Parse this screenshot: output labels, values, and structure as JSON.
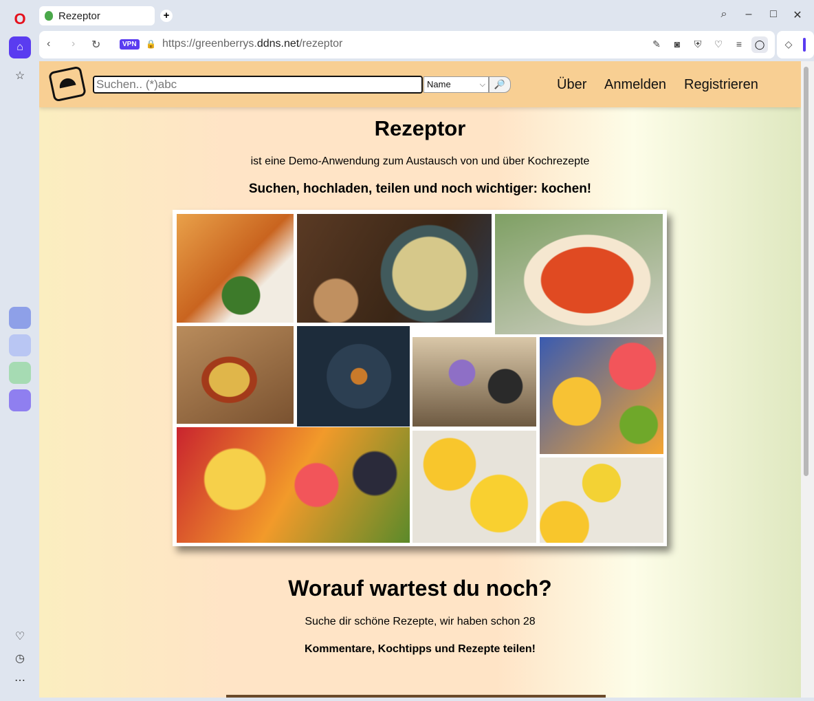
{
  "browser": {
    "tab_title": "Rezeptor",
    "new_tab": "+",
    "vpn": "VPN",
    "url_prefix": "https://greenberrys.",
    "url_domain": "ddns.net",
    "url_path": "/rezeptor"
  },
  "header": {
    "search_placeholder": "Suchen.. (*)abc",
    "select_value": "Name",
    "nav": [
      "Über",
      "Anmelden",
      "Registrieren"
    ]
  },
  "main": {
    "title": "Rezeptor",
    "intro": "ist eine Demo-Anwendung zum Austausch von und über Kochrezepte",
    "tagline": "Suchen, hochladen, teilen und noch wichtiger: kochen!",
    "heading2": "Worauf wartest du noch?",
    "line3": "Suche dir schöne Rezepte, wir haben schon 28",
    "line4": "Kommentare, Kochtipps und Rezepte teilen!"
  },
  "colors": {
    "header_bg": "#f8cf93",
    "accent": "#5a3cf0"
  },
  "icons": [
    "opera-icon",
    "home-icon",
    "star-icon",
    "search-icon",
    "camera-icon",
    "heart-icon"
  ]
}
